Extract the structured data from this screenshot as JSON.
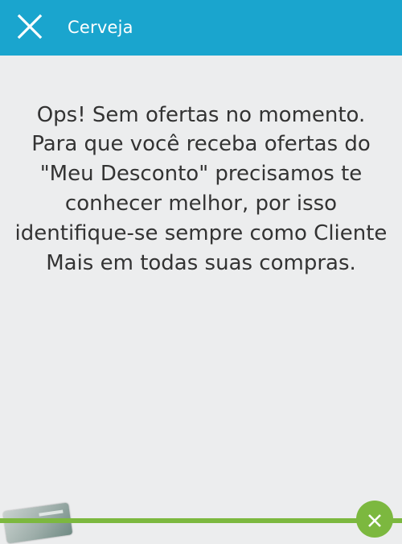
{
  "header": {
    "title": "Cerveja",
    "close_icon": "close-icon"
  },
  "content": {
    "headline": "Ops! Sem ofertas no momento.",
    "message": "Para que você receba ofertas do \"Meu Desconto\" precisamos te conhecer melhor, por isso identifique-se sempre como Cliente Mais em todas suas compras."
  },
  "footer": {
    "card_icon": "loyalty-card-icon",
    "dismiss_icon": "close-icon"
  },
  "colors": {
    "header_background": "#1aa5ce",
    "page_background": "#ecedee",
    "accent_green": "#7cb83f",
    "text": "#333333"
  }
}
